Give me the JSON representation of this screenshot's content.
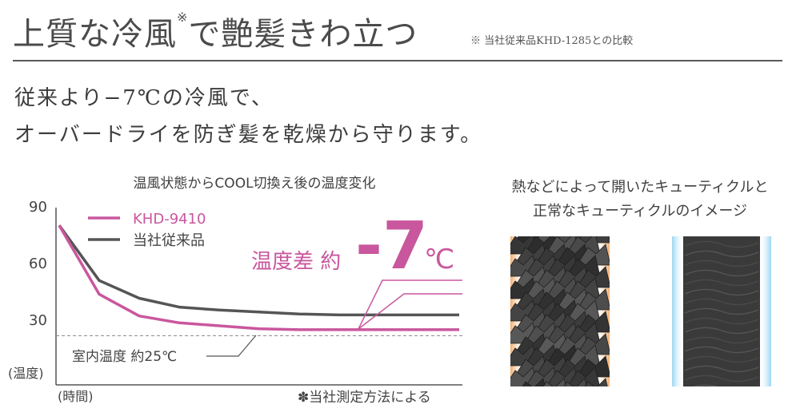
{
  "header": {
    "headline_main": "上質な冷風",
    "headline_mark": "※",
    "headline_tail": "で艶髪きわ立つ",
    "note": "※ 当社従来品KHD-1285との比較"
  },
  "lead": {
    "line1": "従来より−7℃の冷風で、",
    "line2": "オーバードライを防ぎ髪を乾燥から守ります。"
  },
  "chart_data": {
    "type": "line",
    "title": "温風状態からCOOL切換え後の温度変化",
    "ylabel": "(温度)",
    "xlabel": "(時間)",
    "yticks": [
      "90",
      "60",
      "30"
    ],
    "ylim": [
      0,
      90
    ],
    "x": [
      0,
      1,
      2,
      3,
      4,
      5,
      6,
      7,
      8,
      9,
      10
    ],
    "series": [
      {
        "name": "KHD-9410",
        "color": "#c9579d",
        "values": [
          81,
          46,
          35,
          31.5,
          30,
          28.5,
          28,
          28,
          28,
          28,
          28
        ]
      },
      {
        "name": "当社従来品",
        "color": "#555555",
        "values": [
          81,
          53,
          44,
          39.5,
          38,
          37,
          36,
          35.5,
          35.5,
          35.5,
          35.5
        ]
      }
    ],
    "reference_line": {
      "value": 25,
      "label": "室内温度 約25℃"
    },
    "annotation": {
      "prefix": "温度差 約",
      "value": "-7",
      "unit": "℃"
    },
    "footnote": "✽当社測定方法による",
    "grid": false,
    "legend_position": "top-left"
  },
  "illustration": {
    "caption_line1": "熱などによって開いたキューティクルと",
    "caption_line2": "正常なキューティクルのイメージ",
    "colors": {
      "open_glow": "#f3a35a",
      "normal_glow": "#8fd0f0",
      "cuticle": "#3a3a3a"
    }
  }
}
